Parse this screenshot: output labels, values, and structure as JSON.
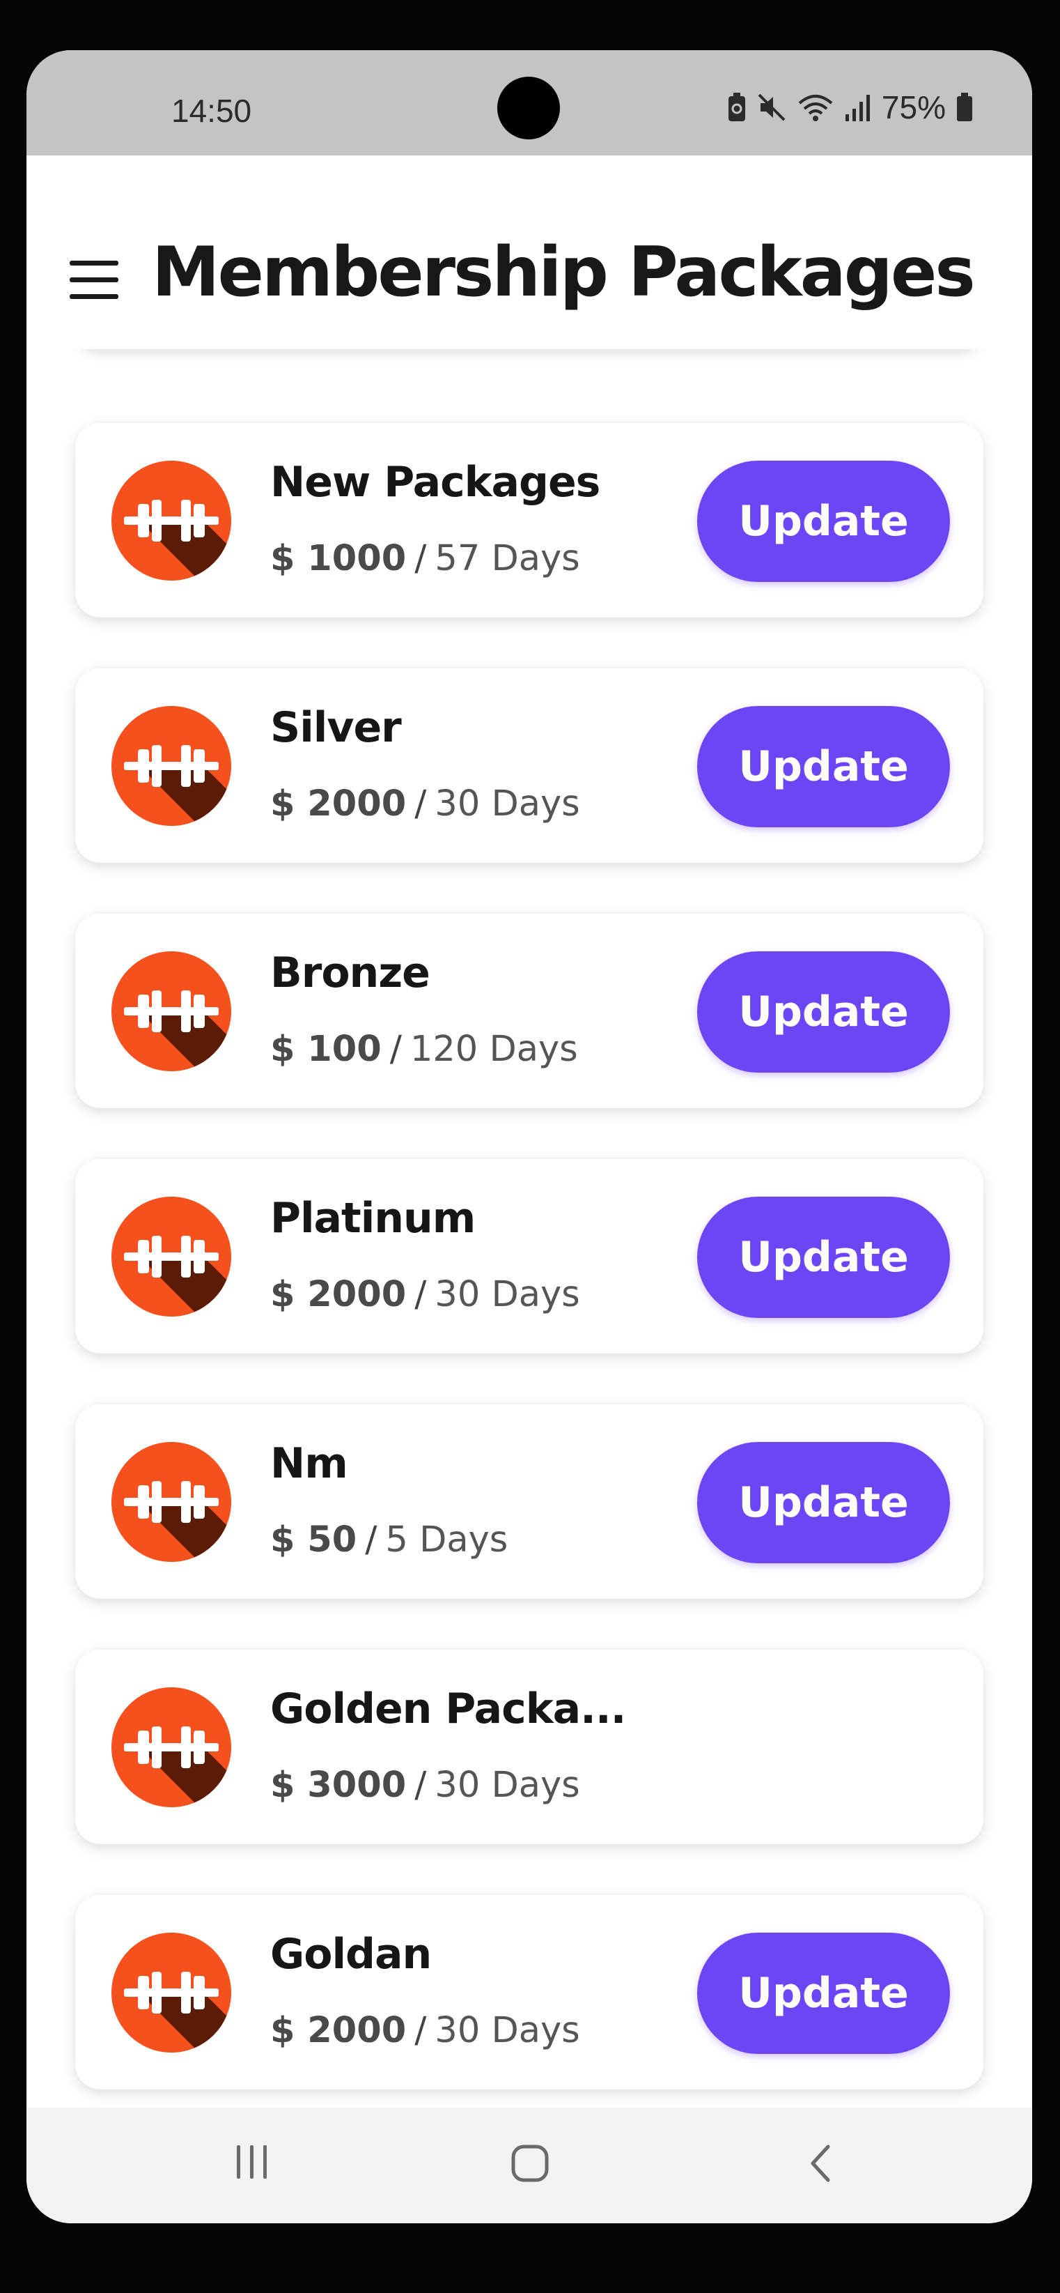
{
  "status_bar": {
    "time": "14:50",
    "battery": "75%"
  },
  "header": {
    "title": "Membership Packages"
  },
  "colors": {
    "accent": "#6c45f5",
    "icon_orange": "#f4511e",
    "icon_shadow": "#5a1c06"
  },
  "packages": [
    {
      "name": "New Packages",
      "price": "$ 1000",
      "sep": "/",
      "duration": "57 Days",
      "button": "Update"
    },
    {
      "name": "Silver",
      "price": "$ 2000",
      "sep": "/",
      "duration": "30 Days",
      "button": "Update"
    },
    {
      "name": "Bronze",
      "price": "$ 100",
      "sep": "/",
      "duration": "120 Days",
      "button": "Update"
    },
    {
      "name": "Platinum",
      "price": "$ 2000",
      "sep": "/",
      "duration": "30 Days",
      "button": "Update"
    },
    {
      "name": "Nm",
      "price": "$ 50",
      "sep": "/",
      "duration": "5 Days",
      "button": "Update"
    },
    {
      "name": "Golden Packa...",
      "price": "$ 3000",
      "sep": "/",
      "duration": "30 Days"
    },
    {
      "name": "Goldan",
      "price": "$ 2000",
      "sep": "/",
      "duration": "30 Days",
      "button": "Update"
    }
  ],
  "icons": {
    "menu": "hamburger-icon",
    "package": "dumbbell-icon",
    "nav": [
      "recents-icon",
      "home-icon",
      "back-icon"
    ]
  }
}
